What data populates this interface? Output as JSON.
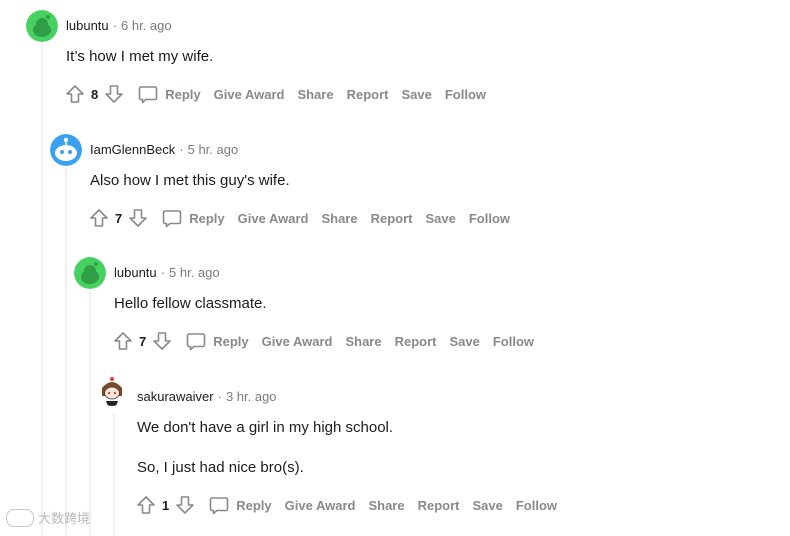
{
  "comments": [
    {
      "author": "lubuntu",
      "separator": "·",
      "time": "6 hr. ago",
      "body": [
        "It’s how I met my wife."
      ],
      "score": "8",
      "actions": {
        "reply": "Reply",
        "give_award": "Give Award",
        "share": "Share",
        "report": "Report",
        "save": "Save",
        "follow": "Follow"
      },
      "avatar_color": "#46d160"
    },
    {
      "author": "IamGlennBeck",
      "separator": "·",
      "time": "5 hr. ago",
      "body": [
        "Also how I met this guy's wife."
      ],
      "score": "7",
      "actions": {
        "reply": "Reply",
        "give_award": "Give Award",
        "share": "Share",
        "report": "Report",
        "save": "Save",
        "follow": "Follow"
      },
      "avatar_color": "#3aa0f0"
    },
    {
      "author": "lubuntu",
      "separator": "·",
      "time": "5 hr. ago",
      "body": [
        "Hello fellow classmate."
      ],
      "score": "7",
      "actions": {
        "reply": "Reply",
        "give_award": "Give Award",
        "share": "Share",
        "report": "Report",
        "save": "Save",
        "follow": "Follow"
      },
      "avatar_color": "#46d160"
    },
    {
      "author": "sakurawaiver",
      "separator": "·",
      "time": "3 hr. ago",
      "body": [
        "We don't have a girl in my high school.",
        "So, I just had nice bro(s)."
      ],
      "score": "1",
      "actions": {
        "reply": "Reply",
        "give_award": "Give Award",
        "share": "Share",
        "report": "Report",
        "save": "Save",
        "follow": "Follow"
      },
      "avatar_color": "#ffffff"
    }
  ],
  "watermark": {
    "text": "大数跨境"
  },
  "icons": {
    "upvote": "upvote-arrow-icon",
    "downvote": "downvote-arrow-icon",
    "reply": "speech-bubble-icon"
  }
}
